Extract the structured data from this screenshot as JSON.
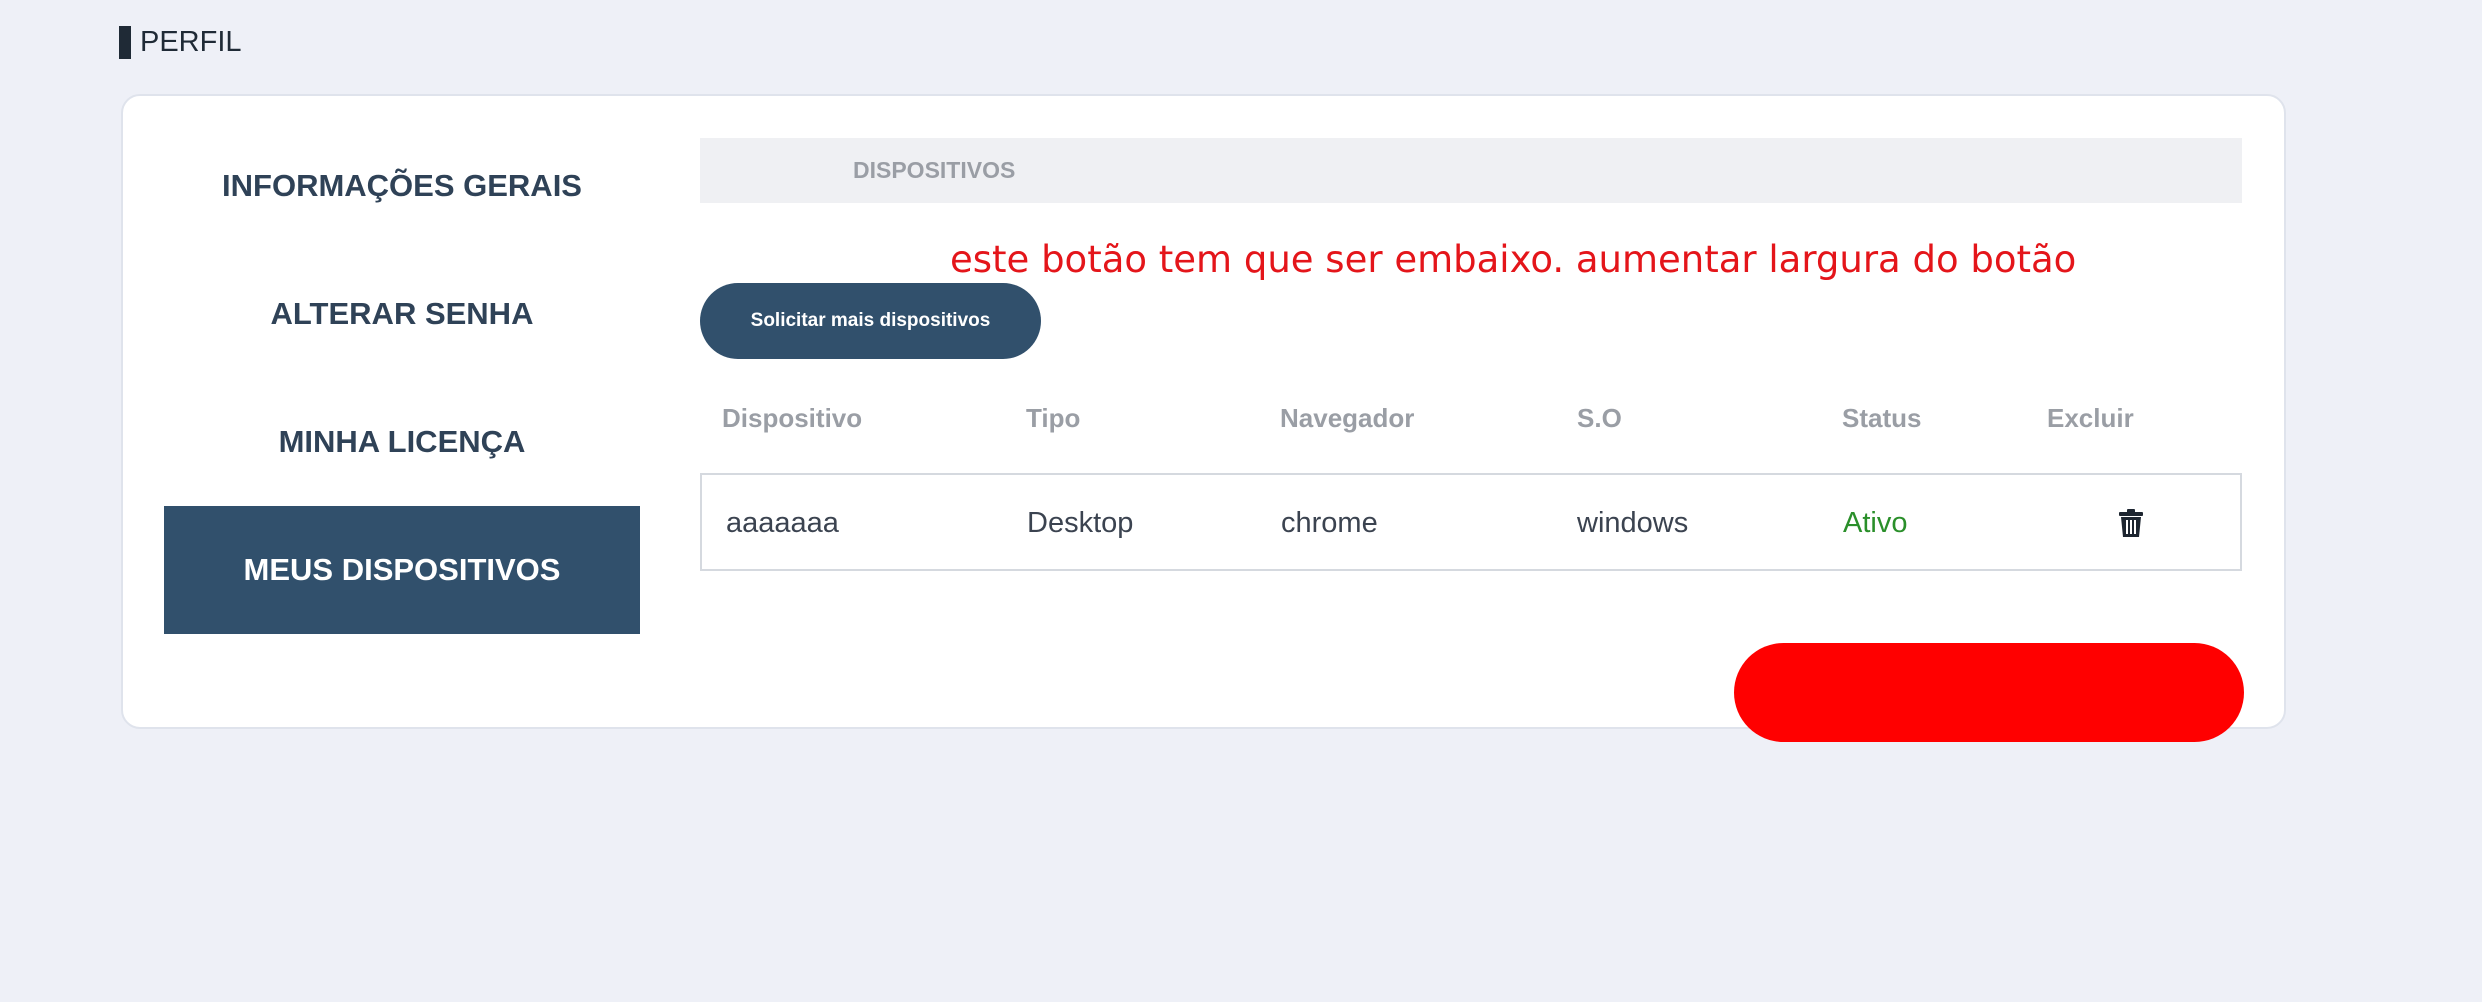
{
  "header": {
    "title": "PERFIL"
  },
  "sidebar": {
    "items": [
      {
        "label": "INFORMAÇÕES GERAIS",
        "active": false
      },
      {
        "label": "ALTERAR SENHA",
        "active": false
      },
      {
        "label": "MINHA LICENÇA",
        "active": false
      },
      {
        "label": "MEUS DISPOSITIVOS",
        "active": true
      }
    ]
  },
  "main": {
    "section_title": "DISPOSITIVOS",
    "annotation": "este botão tem que ser embaixo. aumentar largura do botão",
    "request_button_label": "Solicitar mais dispositivos",
    "table": {
      "columns": [
        "Dispositivo",
        "Tipo",
        "Navegador",
        "S.O",
        "Status",
        "Excluir"
      ],
      "rows": [
        {
          "dispositivo": "aaaaaaa",
          "tipo": "Desktop",
          "navegador": "chrome",
          "so": "windows",
          "status": "Ativo",
          "excluir_icon": "trash-icon"
        }
      ]
    }
  },
  "colors": {
    "accent": "#31506c",
    "status_active": "#2a8f2a",
    "annotation": "#e4151a",
    "highlight_pill": "#ff0000"
  }
}
